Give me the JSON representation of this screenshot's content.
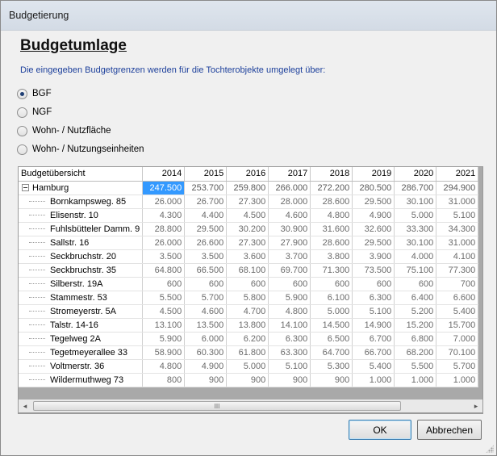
{
  "window": {
    "title": "Budgetierung"
  },
  "heading": "Budgetumlage",
  "description": "Die eingegeben Budgetgrenzen werden für die Tochterobjekte umgelegt über:",
  "options": [
    {
      "label": "BGF",
      "checked": true
    },
    {
      "label": "NGF",
      "checked": false
    },
    {
      "label": "Wohn- / Nutzfläche",
      "checked": false
    },
    {
      "label": "Wohn- / Nutzungseinheiten",
      "checked": false
    }
  ],
  "grid": {
    "header_label": "Budgetübersicht",
    "years": [
      "2014",
      "2015",
      "2016",
      "2017",
      "2018",
      "2019",
      "2020",
      "2021"
    ],
    "rows": [
      {
        "name": "Hamburg",
        "parent": true,
        "values": [
          "247.500",
          "253.700",
          "259.800",
          "266.000",
          "272.200",
          "280.500",
          "286.700",
          "294.900"
        ]
      },
      {
        "name": "Bornkampsweg. 85",
        "values": [
          "26.000",
          "26.700",
          "27.300",
          "28.000",
          "28.600",
          "29.500",
          "30.100",
          "31.000"
        ]
      },
      {
        "name": "Elisenstr. 10",
        "values": [
          "4.300",
          "4.400",
          "4.500",
          "4.600",
          "4.800",
          "4.900",
          "5.000",
          "5.100"
        ]
      },
      {
        "name": "Fuhlsbütteler Damm. 9",
        "values": [
          "28.800",
          "29.500",
          "30.200",
          "30.900",
          "31.600",
          "32.600",
          "33.300",
          "34.300"
        ]
      },
      {
        "name": "Sallstr. 16",
        "values": [
          "26.000",
          "26.600",
          "27.300",
          "27.900",
          "28.600",
          "29.500",
          "30.100",
          "31.000"
        ]
      },
      {
        "name": "Seckbruchstr. 20",
        "values": [
          "3.500",
          "3.500",
          "3.600",
          "3.700",
          "3.800",
          "3.900",
          "4.000",
          "4.100"
        ]
      },
      {
        "name": "Seckbruchstr. 35",
        "values": [
          "64.800",
          "66.500",
          "68.100",
          "69.700",
          "71.300",
          "73.500",
          "75.100",
          "77.300"
        ]
      },
      {
        "name": "Silberstr. 19A",
        "values": [
          "600",
          "600",
          "600",
          "600",
          "600",
          "600",
          "600",
          "700"
        ]
      },
      {
        "name": "Stammestr. 53",
        "values": [
          "5.500",
          "5.700",
          "5.800",
          "5.900",
          "6.100",
          "6.300",
          "6.400",
          "6.600"
        ]
      },
      {
        "name": "Stromeyerstr. 5A",
        "values": [
          "4.500",
          "4.600",
          "4.700",
          "4.800",
          "5.000",
          "5.100",
          "5.200",
          "5.400"
        ]
      },
      {
        "name": "Talstr. 14-16",
        "values": [
          "13.100",
          "13.500",
          "13.800",
          "14.100",
          "14.500",
          "14.900",
          "15.200",
          "15.700"
        ]
      },
      {
        "name": "Tegelweg 2A",
        "values": [
          "5.900",
          "6.000",
          "6.200",
          "6.300",
          "6.500",
          "6.700",
          "6.800",
          "7.000"
        ]
      },
      {
        "name": "Tegetmeyerallee 33",
        "values": [
          "58.900",
          "60.300",
          "61.800",
          "63.300",
          "64.700",
          "66.700",
          "68.200",
          "70.100"
        ]
      },
      {
        "name": "Voltmerstr. 36",
        "values": [
          "4.800",
          "4.900",
          "5.000",
          "5.100",
          "5.300",
          "5.400",
          "5.500",
          "5.700"
        ]
      },
      {
        "name": "Wildermuthweg 73",
        "values": [
          "800",
          "900",
          "900",
          "900",
          "900",
          "1.000",
          "1.000",
          "1.000"
        ]
      }
    ],
    "selected": {
      "row": 0,
      "col": 0
    }
  },
  "scrollbar": {
    "thumb_glyph": "III",
    "left_arrow": "◂",
    "right_arrow": "▸"
  },
  "buttons": {
    "ok": "OK",
    "cancel": "Abbrechen"
  },
  "colors": {
    "selection": "#3399ff",
    "description_text": "#1c3f9b"
  }
}
